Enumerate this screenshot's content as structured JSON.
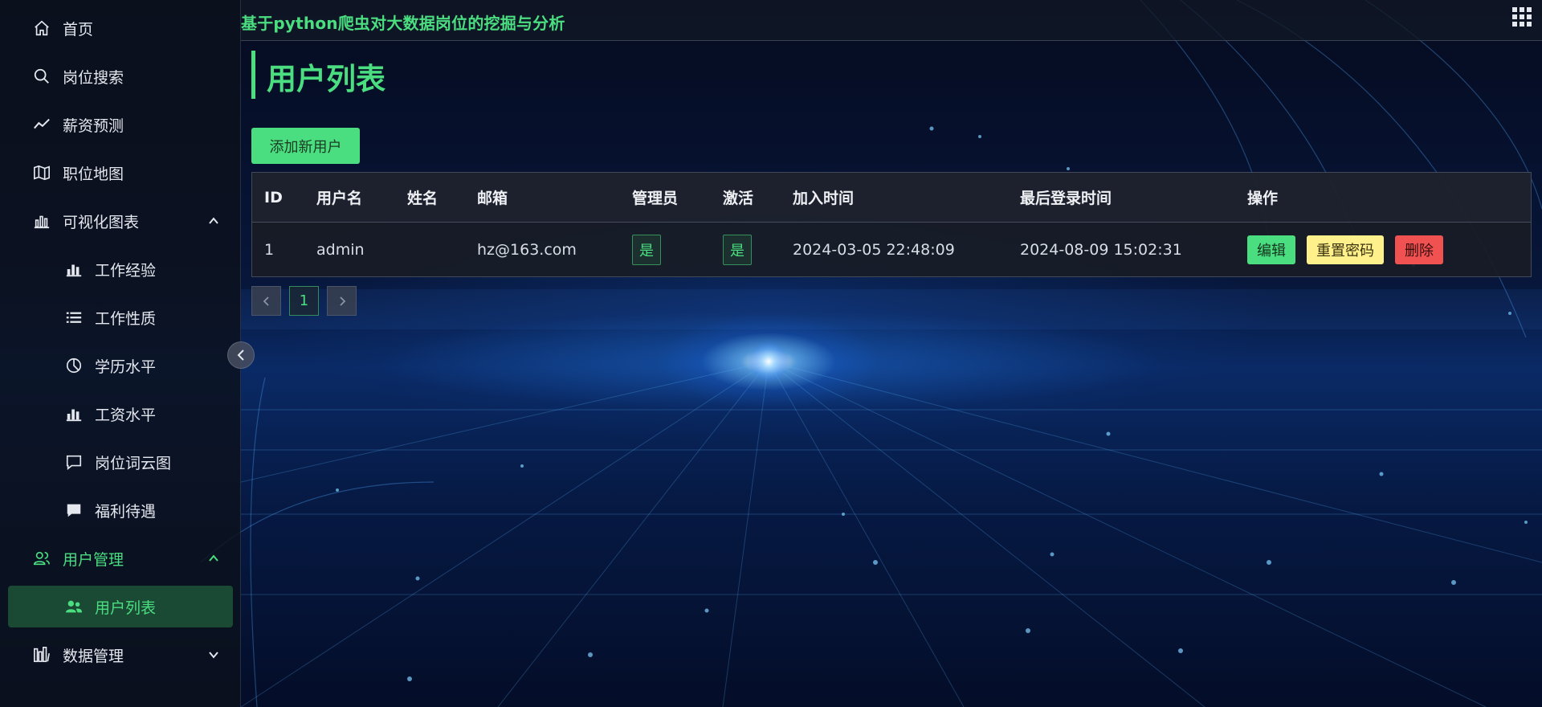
{
  "app": {
    "title": "基于python爬虫对大数据岗位的挖掘与分析"
  },
  "sidebar": {
    "items": [
      {
        "label": "首页",
        "icon": "home-icon"
      },
      {
        "label": "岗位搜索",
        "icon": "search-icon"
      },
      {
        "label": "薪资预测",
        "icon": "trend-icon"
      },
      {
        "label": "职位地图",
        "icon": "map-icon"
      },
      {
        "label": "可视化图表",
        "icon": "bar-chart-outline-icon",
        "expanded": true
      },
      {
        "label": "工作经验",
        "icon": "bar-chart-icon"
      },
      {
        "label": "工作性质",
        "icon": "list-icon"
      },
      {
        "label": "学历水平",
        "icon": "pie-chart-icon"
      },
      {
        "label": "工资水平",
        "icon": "bar-chart-icon"
      },
      {
        "label": "岗位词云图",
        "icon": "chat-outline-icon"
      },
      {
        "label": "福利待遇",
        "icon": "chat-icon"
      },
      {
        "label": "用户管理",
        "icon": "users-icon",
        "expanded": true
      },
      {
        "label": "用户列表",
        "icon": "users-fill-icon",
        "selected": true
      },
      {
        "label": "数据管理",
        "icon": "database-icon",
        "expanded": false
      }
    ]
  },
  "page": {
    "title": "用户列表",
    "add_button": "添加新用户"
  },
  "table": {
    "columns": [
      "ID",
      "用户名",
      "姓名",
      "邮箱",
      "管理员",
      "激活",
      "加入时间",
      "最后登录时间",
      "操作"
    ],
    "rows": [
      {
        "id": "1",
        "username": "admin",
        "name": "",
        "email": "hz@163.com",
        "admin": "是",
        "active": "是",
        "joined": "2024-03-05 22:48:09",
        "last_login": "2024-08-09 15:02:31",
        "actions": {
          "edit": "编辑",
          "reset": "重置密码",
          "delete": "删除"
        }
      }
    ]
  },
  "pagination": {
    "current": "1"
  },
  "colors": {
    "accent": "#4ade80",
    "warning": "#fef08a",
    "danger": "#f05252"
  }
}
